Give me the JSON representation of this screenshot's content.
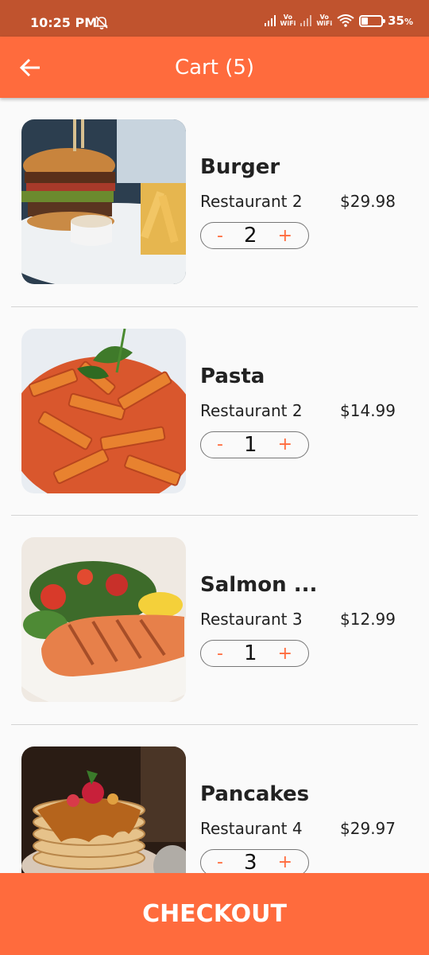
{
  "status_bar": {
    "time": "10:25 PM",
    "battery": "35",
    "battery_unit": "%",
    "network_label_1": "Vo\nWiFi",
    "network_label_2": "Vo\nWiFi",
    "icons": [
      "bell-off-icon",
      "signal-icon",
      "wifi-icon",
      "battery-icon"
    ]
  },
  "header": {
    "title": "Cart (5)",
    "back_icon": "arrow-left-icon"
  },
  "cart": {
    "items": [
      {
        "name": "Burger",
        "restaurant": "Restaurant 2",
        "price": "$29.98",
        "quantity": "2",
        "minus": "-",
        "plus": "+",
        "image": "burger-photo"
      },
      {
        "name": "Pasta",
        "restaurant": "Restaurant 2",
        "price": "$14.99",
        "quantity": "1",
        "minus": "-",
        "plus": "+",
        "image": "pasta-photo"
      },
      {
        "name": "Salmon ...",
        "restaurant": "Restaurant 3",
        "price": "$12.99",
        "quantity": "1",
        "minus": "-",
        "plus": "+",
        "image": "salmon-photo"
      },
      {
        "name": "Pancakes",
        "restaurant": "Restaurant 4",
        "price": "$29.97",
        "quantity": "3",
        "minus": "-",
        "plus": "+",
        "image": "pancakes-photo"
      }
    ]
  },
  "footer": {
    "checkout_label": "CHECKOUT"
  },
  "colors": {
    "accent": "#ff6b3d",
    "status_bar": "#c0532e",
    "background": "#fafafa",
    "divider": "#d4d4d4"
  }
}
